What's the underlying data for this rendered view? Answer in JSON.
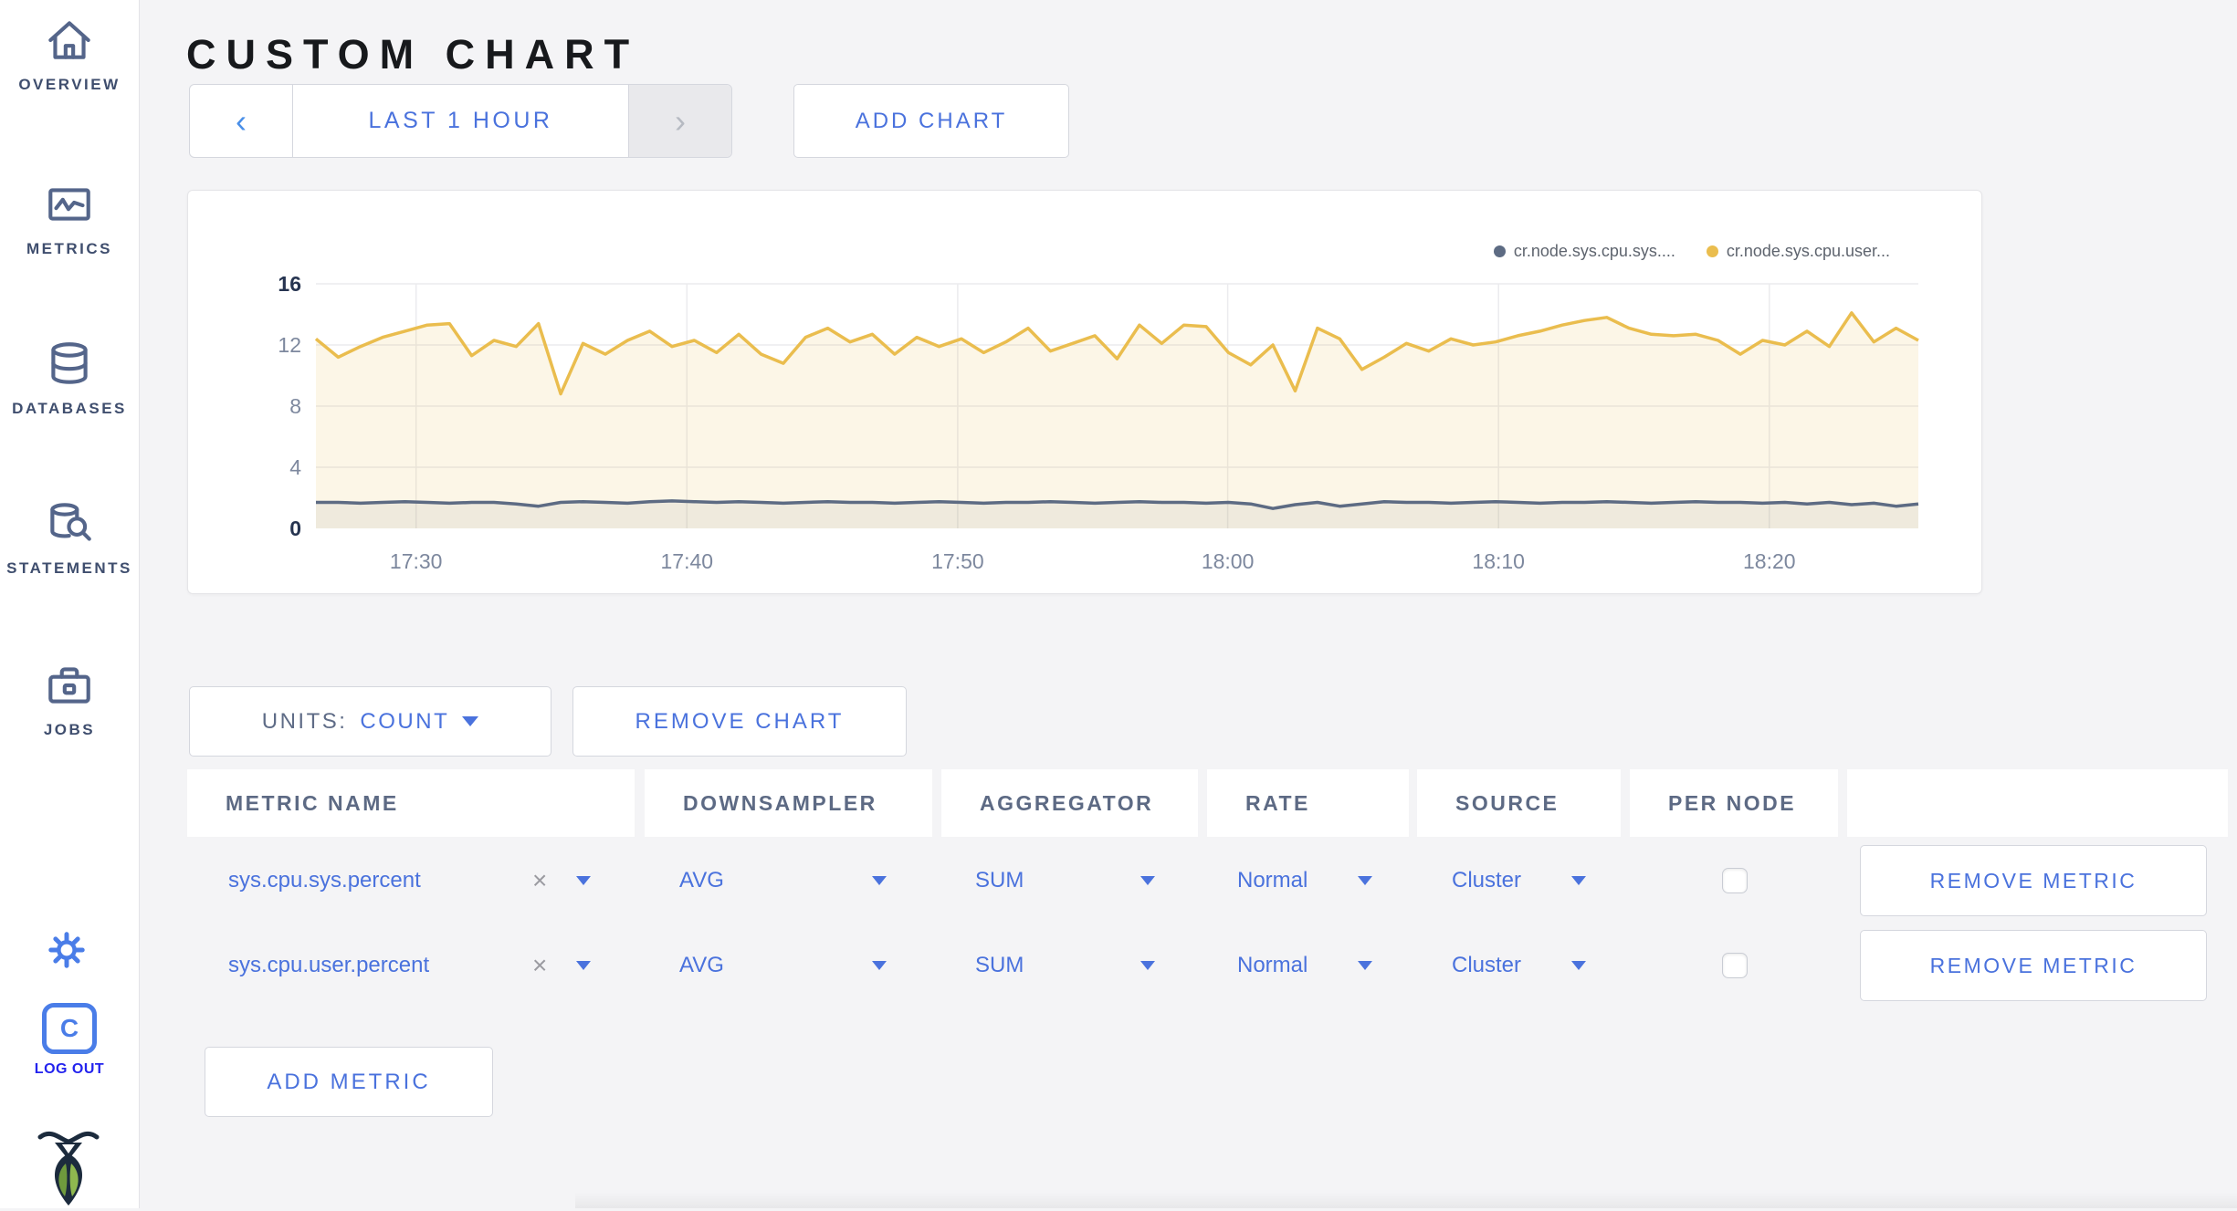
{
  "page": {
    "title": "CUSTOM CHART"
  },
  "sidebar": {
    "items": [
      {
        "label": "OVERVIEW",
        "icon": "home-icon"
      },
      {
        "label": "METRICS",
        "icon": "metrics-icon"
      },
      {
        "label": "DATABASES",
        "icon": "databases-icon"
      },
      {
        "label": "STATEMENTS",
        "icon": "statements-icon"
      },
      {
        "label": "JOBS",
        "icon": "jobs-icon"
      }
    ],
    "logout": {
      "monogram": "C",
      "label": "LOG OUT"
    }
  },
  "toolbar": {
    "time_range": {
      "prev": "‹",
      "label": "LAST 1 HOUR",
      "next": "›"
    },
    "add_chart_label": "ADD CHART"
  },
  "chart_controls": {
    "units_label": "UNITS:",
    "units_value": "COUNT",
    "remove_chart_label": "REMOVE CHART",
    "add_metric_label": "ADD METRIC"
  },
  "metrics_table": {
    "headers": [
      "METRIC NAME",
      "DOWNSAMPLER",
      "AGGREGATOR",
      "RATE",
      "SOURCE",
      "PER NODE",
      ""
    ],
    "rows": [
      {
        "metric_name": "sys.cpu.sys.percent",
        "clear": "×",
        "downsampler": "AVG",
        "aggregator": "SUM",
        "rate": "Normal",
        "source": "Cluster",
        "per_node_checked": false,
        "remove_label": "REMOVE METRIC"
      },
      {
        "metric_name": "sys.cpu.user.percent",
        "clear": "×",
        "downsampler": "AVG",
        "aggregator": "SUM",
        "rate": "Normal",
        "source": "Cluster",
        "per_node_checked": false,
        "remove_label": "REMOVE METRIC"
      }
    ]
  },
  "colors": {
    "accent_blue": "#4a72dd",
    "series_sys": "#5d6b83",
    "series_user": "#eabd4e"
  },
  "chart_data": {
    "type": "line",
    "title": "",
    "xlabel": "",
    "ylabel": "",
    "ylim": [
      0,
      16
    ],
    "y_ticks": [
      0,
      4,
      8,
      12,
      16
    ],
    "x_tick_labels": [
      "17:30",
      "17:40",
      "17:50",
      "18:00",
      "18:10",
      "18:20"
    ],
    "x_tick_fractions": [
      0.0625,
      0.2315,
      0.4005,
      0.569,
      0.738,
      0.907
    ],
    "grid": true,
    "legend_position": "top-right",
    "series": [
      {
        "name": "cr.node.sys.cpu.sys....",
        "color": "#5d6b83",
        "fill": "rgba(93,107,131,0.09)",
        "values": [
          1.7,
          1.7,
          1.65,
          1.7,
          1.75,
          1.7,
          1.65,
          1.7,
          1.7,
          1.6,
          1.45,
          1.7,
          1.75,
          1.7,
          1.65,
          1.75,
          1.8,
          1.75,
          1.7,
          1.75,
          1.7,
          1.65,
          1.7,
          1.75,
          1.7,
          1.7,
          1.65,
          1.7,
          1.75,
          1.7,
          1.65,
          1.7,
          1.7,
          1.75,
          1.7,
          1.65,
          1.7,
          1.75,
          1.7,
          1.7,
          1.65,
          1.7,
          1.6,
          1.3,
          1.55,
          1.7,
          1.45,
          1.6,
          1.75,
          1.7,
          1.7,
          1.65,
          1.7,
          1.75,
          1.7,
          1.65,
          1.7,
          1.7,
          1.75,
          1.7,
          1.65,
          1.7,
          1.75,
          1.7,
          1.7,
          1.65,
          1.7,
          1.6,
          1.7,
          1.55,
          1.65,
          1.45,
          1.6
        ]
      },
      {
        "name": "cr.node.sys.cpu.user...",
        "color": "#eabd4e",
        "fill": "rgba(234,185,70,0.13)",
        "values": [
          12.4,
          11.2,
          11.9,
          12.5,
          12.9,
          13.3,
          13.4,
          11.3,
          12.3,
          11.9,
          13.4,
          8.8,
          12.1,
          11.4,
          12.3,
          12.9,
          11.9,
          12.3,
          11.5,
          12.7,
          11.4,
          10.8,
          12.5,
          13.1,
          12.2,
          12.7,
          11.4,
          12.5,
          11.9,
          12.4,
          11.5,
          12.2,
          13.1,
          11.6,
          12.1,
          12.6,
          11.1,
          13.3,
          12.1,
          13.3,
          13.2,
          11.5,
          10.7,
          12.0,
          9.0,
          13.1,
          12.4,
          10.4,
          11.2,
          12.1,
          11.6,
          12.4,
          12.0,
          12.2,
          12.6,
          12.9,
          13.3,
          13.6,
          13.8,
          13.1,
          12.7,
          12.6,
          12.7,
          12.3,
          11.4,
          12.3,
          12.0,
          12.9,
          11.9,
          14.1,
          12.2,
          13.1,
          12.3
        ]
      }
    ]
  }
}
